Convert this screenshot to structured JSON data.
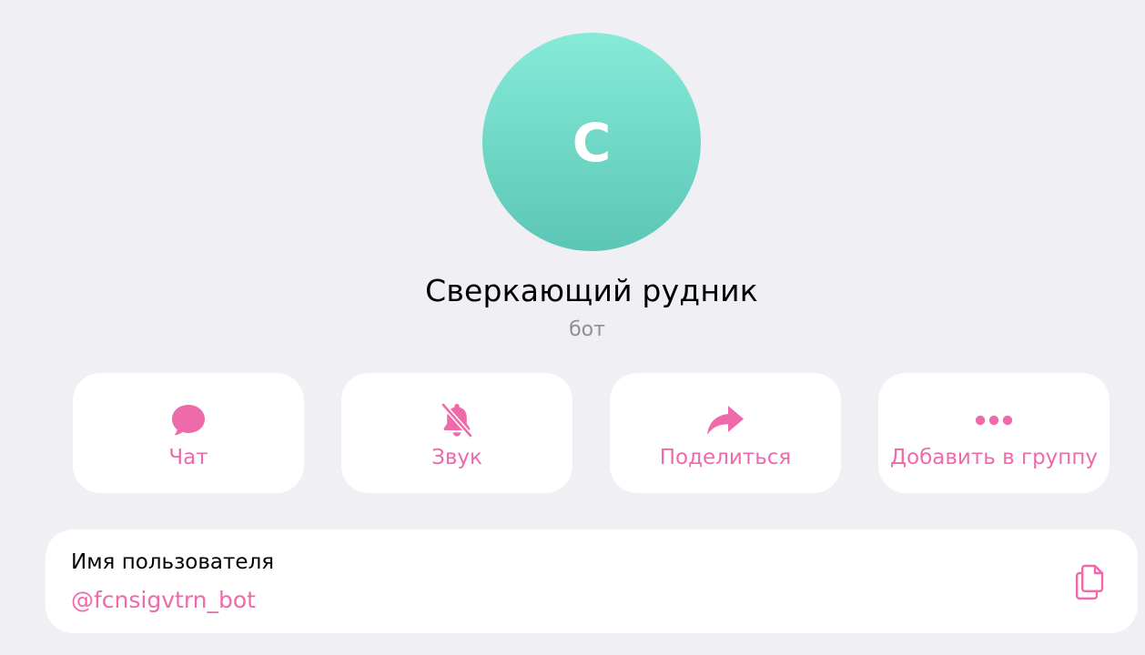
{
  "profile": {
    "avatar_letter": "С",
    "name": "Сверкающий рудник",
    "status": "бот"
  },
  "actions": [
    {
      "label": "Чат",
      "icon": "chat-bubble-icon"
    },
    {
      "label": "Звук",
      "icon": "bell-slash-icon"
    },
    {
      "label": "Поделиться",
      "icon": "share-arrow-icon"
    },
    {
      "label": "Добавить в группу",
      "icon": "more-dots-icon"
    }
  ],
  "info": {
    "username_label": "Имя пользователя",
    "username_value": "@fcnsigvtrn_bot",
    "copy_icon": "copy-icon"
  },
  "colors": {
    "accent": "#ee6aab",
    "background": "#efeff4",
    "avatar_top": "#86ead8",
    "avatar_bottom": "#5cc6b6",
    "secondary_text": "#8e8e93"
  }
}
